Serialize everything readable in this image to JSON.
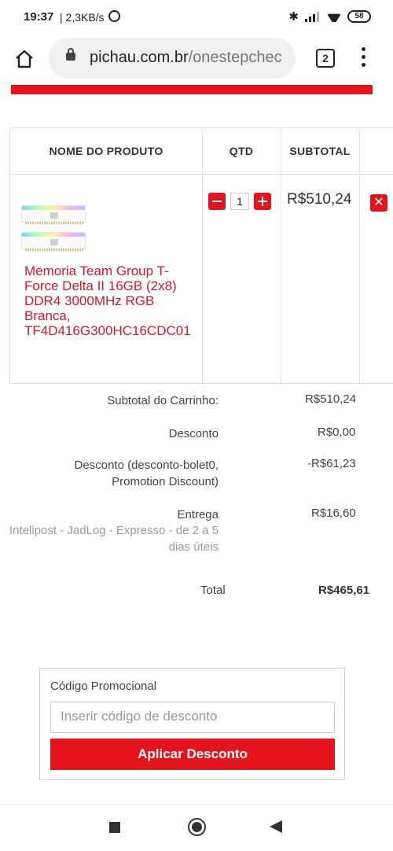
{
  "status_bar": {
    "time": "19:37",
    "speed": "| 2,3KB/s",
    "battery": "58"
  },
  "browser": {
    "url_domain": "pichau.com.br",
    "url_path": "/onestepchec",
    "tab_count": "2"
  },
  "cart": {
    "headers": {
      "product": "NOME DO PRODUTO",
      "qty": "QTD",
      "subtotal": "SUBTOTAL"
    },
    "item": {
      "name": "Memoria Team Group T-Force Delta II 16GB (2x8) DDR4 3000MHz RGB Branca, TF4D416G300HC16CDC01",
      "qty": "1",
      "subtotal": "R$510,24",
      "minus_icon": "minus-icon",
      "plus_icon": "plus-icon",
      "remove_icon": "close-icon"
    }
  },
  "totals": {
    "cart_subtotal_label": "Subtotal do Carrinho:",
    "cart_subtotal_value": "R$510,24",
    "discount_label": "Desconto",
    "discount_value": "R$0,00",
    "discount_detail_label_1": "Desconto (desconto-bolet0,",
    "discount_detail_label_2": "Promotion Discount)",
    "discount_detail_value": "-R$61,23",
    "shipping_label": "Entrega",
    "shipping_detail": "Intelipost - JadLog - Expresso - de 2 a 5 dias úteis",
    "shipping_value": "R$16,60",
    "total_label": "Total",
    "total_value": "R$465,61"
  },
  "coupon": {
    "title": "Código Promocional",
    "placeholder": "Inserir código de desconto",
    "button": "Aplicar Desconto"
  },
  "colors": {
    "accent": "#e3141b",
    "product_link": "#d4172a"
  }
}
